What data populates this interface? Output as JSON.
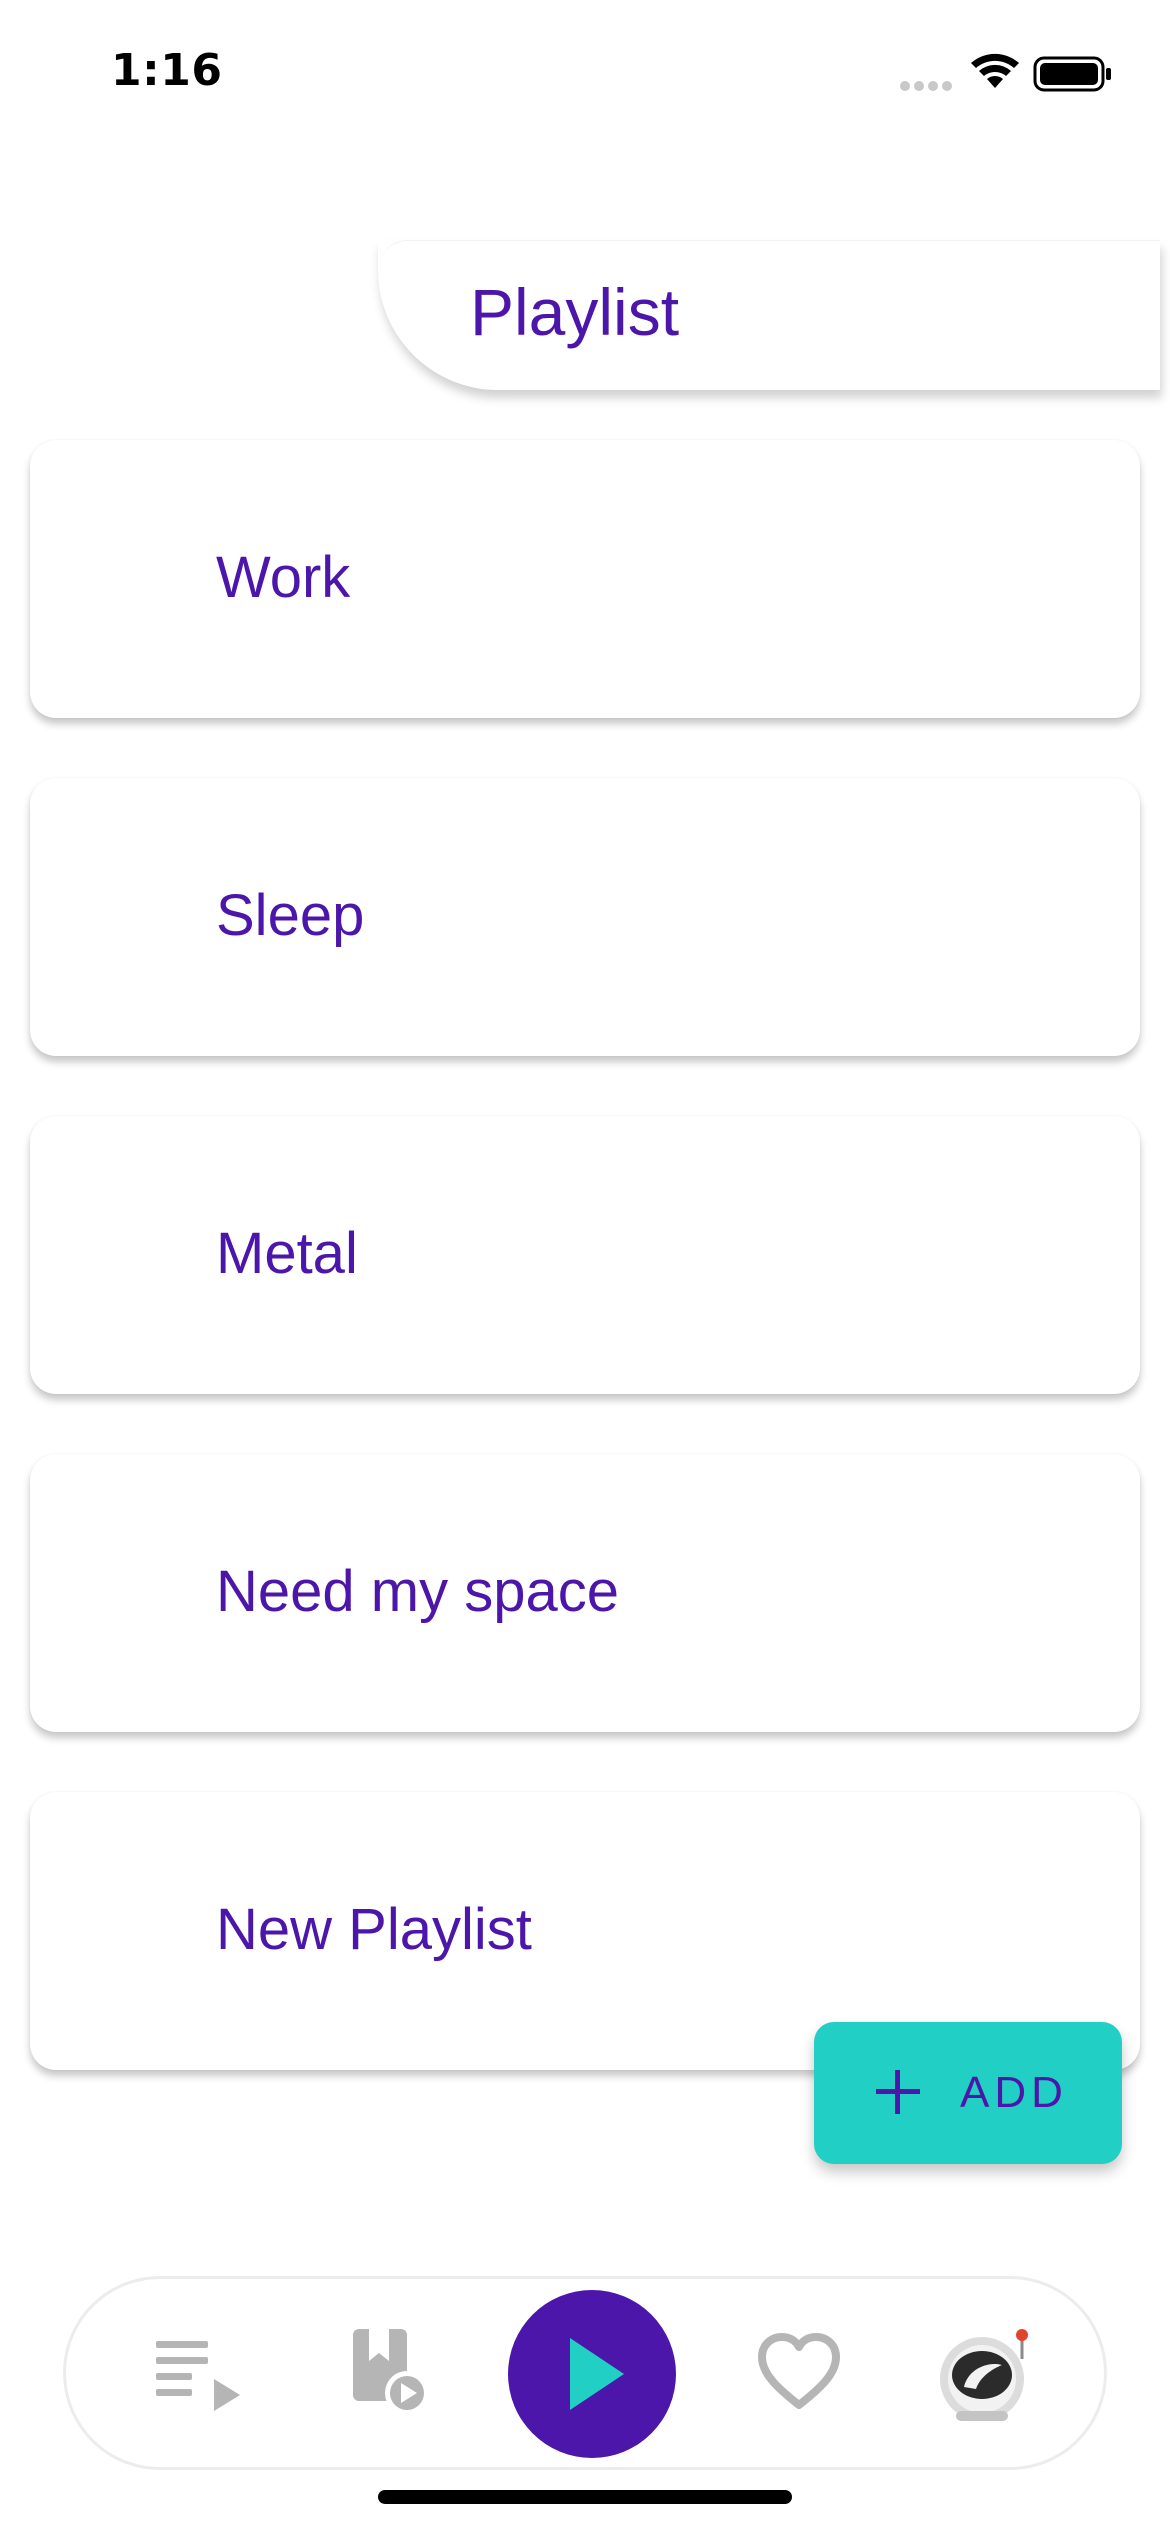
{
  "status_bar": {
    "time": "1:16"
  },
  "header": {
    "title": "Playlist"
  },
  "playlists": [
    {
      "label": "Work"
    },
    {
      "label": "Sleep"
    },
    {
      "label": "Metal"
    },
    {
      "label": "Need my space"
    },
    {
      "label": "New Playlist"
    }
  ],
  "add_button": {
    "label": "ADD",
    "icon": "plus-icon"
  },
  "bottom_nav": {
    "items": [
      {
        "icon": "queue-icon",
        "active": false
      },
      {
        "icon": "library-icon",
        "active": false
      },
      {
        "icon": "play-icon",
        "active": true
      },
      {
        "icon": "heart-icon",
        "active": false
      },
      {
        "icon": "astronaut-profile-icon",
        "active": false
      }
    ]
  },
  "colors": {
    "primary": "#4b16a9",
    "accent": "#22cfc4",
    "inactive_icon": "#b5b5b5",
    "background": "#ffffff"
  }
}
